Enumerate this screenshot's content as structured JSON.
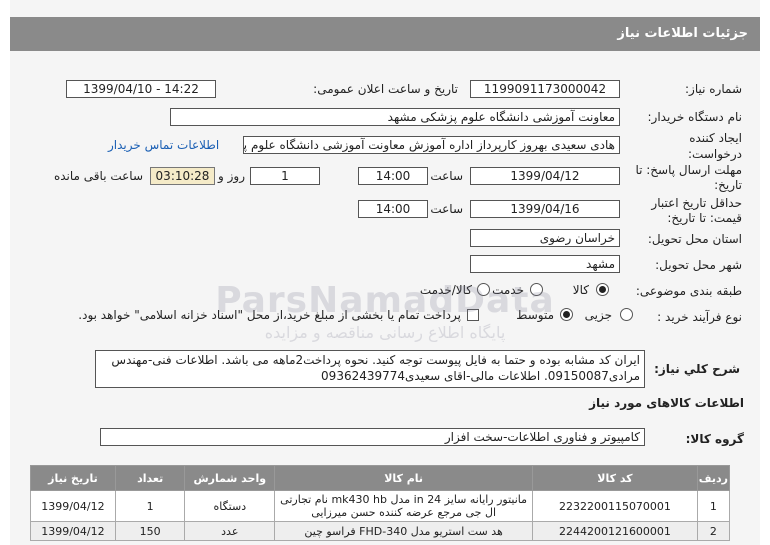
{
  "title": "جزئیات اطلاعات نیاز",
  "labels": {
    "need_number": "شماره نیاز:",
    "announce_datetime": "تاریخ و ساعت اعلان عمومی:",
    "buyer_org": "نام دستگاه خریدار:",
    "requester": "ایجاد کننده درخواست:",
    "reply_deadline": "مهلت ارسال پاسخ: تا تاریخ:",
    "price_validity": "حداقل تاریخ اعتبار قیمت: تا تاریخ:",
    "time": "ساعت",
    "day_and": "روز و",
    "remaining": "ساعت باقی مانده",
    "province": "استان محل تحویل:",
    "city": "شهر محل تحویل:",
    "category": "طبقه بندی موضوعی:",
    "purchase_process": "نوع فرآیند خرید :",
    "description": "شرح کلي نياز:",
    "goods_info": "اطلاعات کالاهای مورد نیاز",
    "goods_group": "گروه کالا:"
  },
  "values": {
    "need_number": "1199091173000042",
    "announce_datetime": "1399/04/10 - 14:22",
    "buyer_org": "معاونت آموزشی دانشگاه علوم پزشکی مشهد",
    "requester": "هادی سعیدی بهروز کارپرداز اداره آموزش معاونت آموزشی دانشگاه علوم پزشکی",
    "contact_link": "اطلاعات تماس خریدار",
    "reply_date": "1399/04/12",
    "reply_time": "14:00",
    "days": "1",
    "countdown": "03:10:28",
    "validity_date": "1399/04/16",
    "validity_time": "14:00",
    "province": "خراسان رضوی",
    "city": "مشهد",
    "goods_group": "کامپیوتر و فناوری اطلاعات-سخت افزار",
    "description": "ایران کد مشابه بوده و حتما به فایل پیوست توجه کنید. نحوه پرداخت2ماهه می باشد. اطلاعات فنی-مهندس مرادی09150087. اطلاعات مالی-اقای سعیدی09362439774"
  },
  "category_options": [
    {
      "label": "کالا",
      "selected": true
    },
    {
      "label": "خدمت",
      "selected": false
    },
    {
      "label": "کالا/خدمت",
      "selected": false
    }
  ],
  "process_options": [
    {
      "label": "جزیی",
      "selected": false
    },
    {
      "label": "متوسط",
      "selected": true
    }
  ],
  "payment_note": "پرداخت تمام یا بخشی از مبلغ خرید،از محل \"اسناد خزانه اسلامی\" خواهد بود.",
  "watermark": {
    "line1": "ParsNamadData",
    "line2": "پایگاه اطلاع رسانی مناقصه و مزایده",
    "line3": "۰۲۱-۸۸۳۴۹۶۷۰-۵"
  },
  "table": {
    "headers": [
      "ردیف",
      "کد کالا",
      "نام کالا",
      "واحد شمارش",
      "تعداد",
      "تاریخ نیاز"
    ],
    "rows": [
      [
        "1",
        "2232200115070001",
        "مانیتور رایانه سایز 24 in مدل mk430 hb نام تجارتی ال جی مرجع عرضه کننده حسن میرزایی",
        "دستگاه",
        "1",
        "1399/04/12"
      ],
      [
        "2",
        "2244200121600001",
        "هد ست استریو مدل FHD-340 فراسو چین",
        "عدد",
        "150",
        "1399/04/12"
      ]
    ]
  },
  "colors": {
    "header_gray": "#8a8a8a",
    "link_blue": "#1a5fb4",
    "timer_bg": "#f5ebc8"
  }
}
